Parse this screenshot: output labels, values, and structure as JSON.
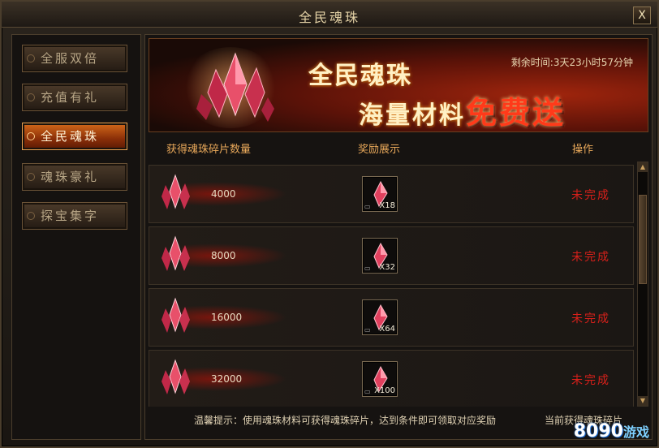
{
  "window": {
    "title": "全民魂珠",
    "close_label": "X"
  },
  "sidebar": {
    "tabs": [
      {
        "label": "全服双倍"
      },
      {
        "label": "充值有礼"
      },
      {
        "label": "全民魂珠"
      },
      {
        "label": "魂珠豪礼"
      },
      {
        "label": "探宝集字"
      }
    ],
    "active_index": 2
  },
  "banner": {
    "title": "全民魂珠",
    "subtitle_main": "海量材料",
    "subtitle_free": "免费送",
    "countdown_label": "剩余时间:",
    "countdown_value": "3天23小时57分钟"
  },
  "table": {
    "headers": {
      "count": "获得魂珠碎片数量",
      "reward": "奖励展示",
      "action": "操作"
    },
    "rows": [
      {
        "count": "4000",
        "reward_qty": "X18",
        "status": "未完成"
      },
      {
        "count": "8000",
        "reward_qty": "X32",
        "status": "未完成"
      },
      {
        "count": "16000",
        "reward_qty": "X64",
        "status": "未完成"
      },
      {
        "count": "32000",
        "reward_qty": "X100",
        "status": "未完成"
      }
    ]
  },
  "footer": {
    "tip": "温馨提示：使用魂珠材料可获得魂珠碎片，达到条件即可领取对应奖励",
    "current_count_label": "当前获得魂珠碎片"
  },
  "watermark": {
    "number": "8090",
    "text": "游戏"
  },
  "colors": {
    "accent": "#d46a1a",
    "status_incomplete": "#d8201a",
    "header_text": "#e8a85a"
  }
}
